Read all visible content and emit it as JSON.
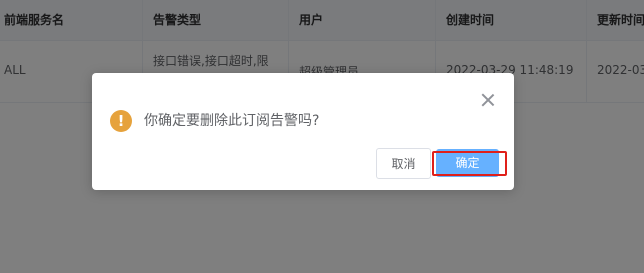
{
  "table": {
    "headers": [
      "前端服务名",
      "告警类型",
      "用户",
      "创建时间",
      "更新时间"
    ],
    "row": {
      "service": "ALL",
      "alert_type_line1": "接口错误,接口超时,限",
      "alert_type_line2": "...",
      "user": "超级管理员",
      "created": "2022-03-29 11:48:19",
      "updated": "2022-03-"
    }
  },
  "dialog": {
    "message": "你确定要删除此订阅告警吗?",
    "icon": "warning-icon",
    "icon_glyph": "!",
    "cancel_label": "取消",
    "confirm_label": "确定",
    "highlight_color": "#e0201a",
    "confirm_color": "#66b1ff",
    "warning_color": "#e6a23c"
  }
}
